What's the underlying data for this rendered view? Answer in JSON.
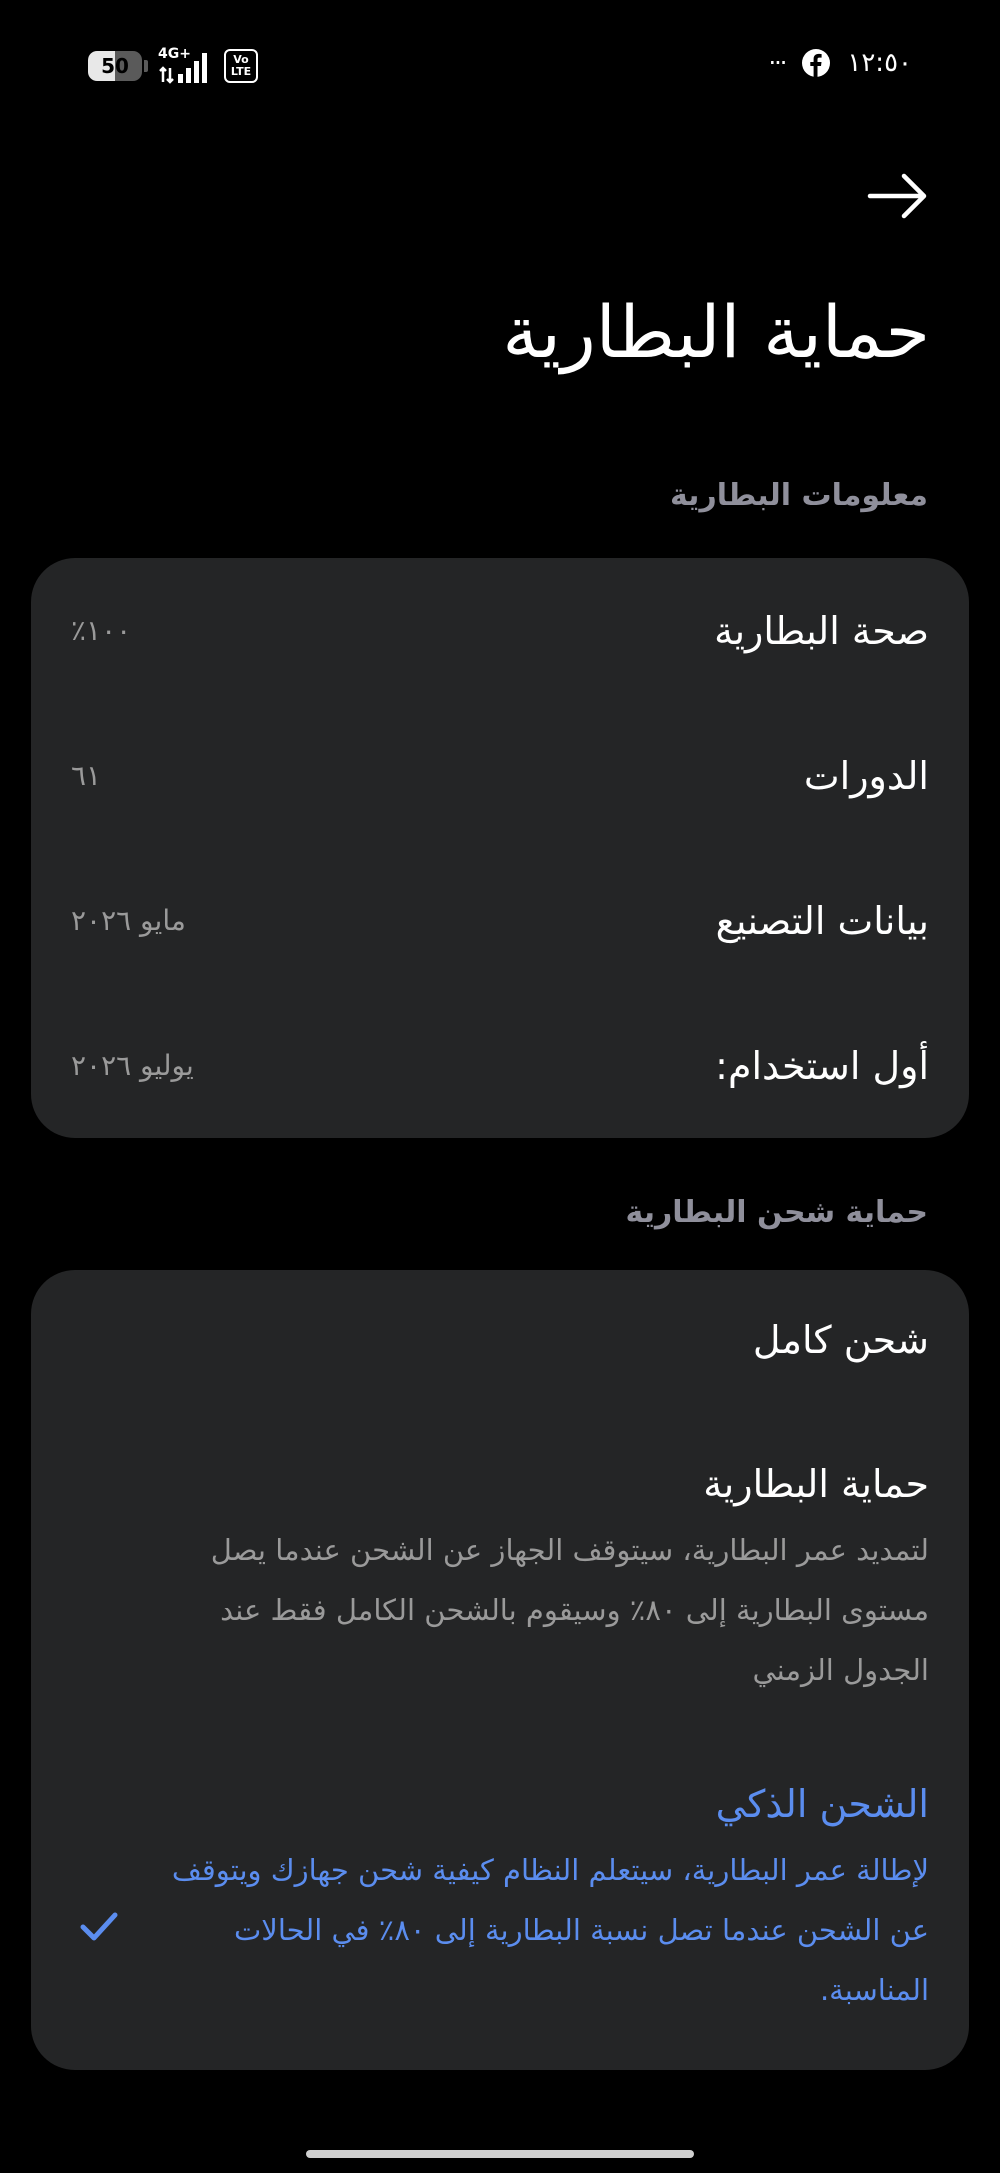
{
  "status_bar": {
    "time": "١٢:٥٠",
    "battery_level": 50,
    "battery_text": "50",
    "network": "4G+",
    "volte_top": "Vo",
    "volte_bottom": "LTE",
    "more": "···",
    "icons": [
      "facebook-icon",
      "signal-icon",
      "volte-icon",
      "battery-icon",
      "more-icon"
    ]
  },
  "header": {
    "back_icon": "arrow-right-icon",
    "title": "حماية البطارية"
  },
  "battery_info": {
    "section_title": "معلومات البطارية",
    "rows": [
      {
        "label": "صحة البطارية",
        "value": "١٠٠٪"
      },
      {
        "label": "الدورات",
        "value": "٦١"
      },
      {
        "label": "بيانات التصنيع",
        "value": "مايو ٢٠٢٦"
      },
      {
        "label": "أول استخدام:",
        "value": "يوليو ٢٠٢٦"
      }
    ]
  },
  "charging_protection": {
    "section_title": "حماية شحن البطارية",
    "options": [
      {
        "title": "شحن كامل",
        "description": "",
        "selected": false
      },
      {
        "title": "حماية البطارية",
        "description": "لتمديد عمر البطارية، سيتوقف الجهاز عن الشحن عندما يصل مستوى البطارية إلى ٨٠٪ وسيقوم بالشحن الكامل فقط عند الجدول الزمني",
        "selected": false
      },
      {
        "title": "الشحن الذكي",
        "description": "لإطالة عمر البطارية، سيتعلم النظام كيفية شحن جهازك ويتوقف عن الشحن عندما تصل نسبة البطارية إلى ٨٠٪ في الحالات المناسبة.",
        "selected": true
      }
    ]
  },
  "colors": {
    "background": "#000000",
    "card": "#242526",
    "accent": "#5b8def",
    "secondary_text": "#9a9a9a",
    "section_header": "#8f8f9b"
  }
}
